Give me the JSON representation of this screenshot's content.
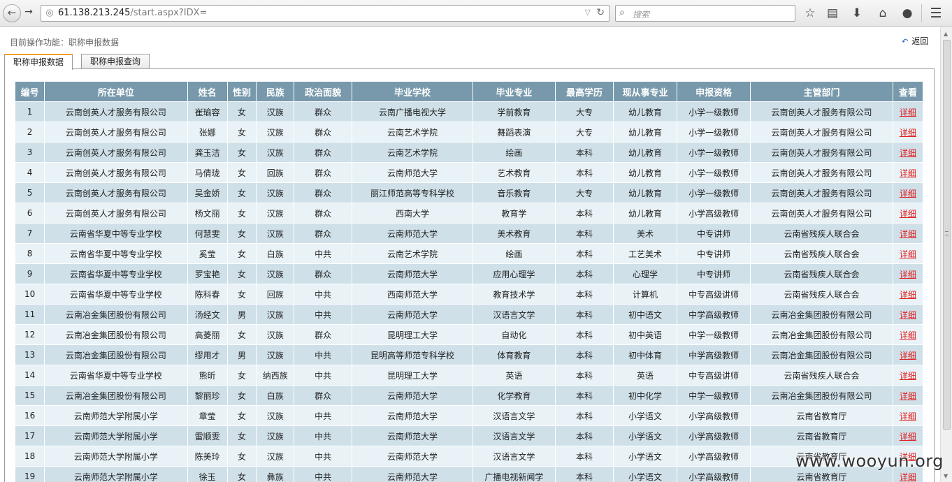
{
  "browser": {
    "url_host": "61.138.213.245",
    "url_path": "/start.aspx?IDX=",
    "search_placeholder": "搜索",
    "icons": [
      "back-icon",
      "forward-icon",
      "globe-icon",
      "reload-icon",
      "search-icon",
      "bookmark-star-icon",
      "reader-icon",
      "download-icon",
      "home-icon",
      "chat-icon",
      "menu-icon"
    ]
  },
  "page": {
    "operation_label": "目前操作功能：职称申报数据",
    "back_label": "返回",
    "tabs": [
      {
        "label": "职称申报数据",
        "active": true
      },
      {
        "label": "职称申报查询",
        "active": false
      }
    ]
  },
  "table": {
    "columns": [
      "编号",
      "所在单位",
      "姓名",
      "性别",
      "民族",
      "政治面貌",
      "毕业学校",
      "毕业专业",
      "最高学历",
      "现从事专业",
      "申报资格",
      "主管部门",
      "查看"
    ],
    "link_label": "详细",
    "rows": [
      [
        "1",
        "云南创英人才服务有限公司",
        "崔瑜容",
        "女",
        "汉族",
        "群众",
        "云南广播电视大学",
        "学前教育",
        "大专",
        "幼儿教育",
        "小学一级教师",
        "云南创英人才服务有限公司"
      ],
      [
        "2",
        "云南创英人才服务有限公司",
        "张娜",
        "女",
        "汉族",
        "群众",
        "云南艺术学院",
        "舞蹈表演",
        "大专",
        "幼儿教育",
        "小学一级教师",
        "云南创英人才服务有限公司"
      ],
      [
        "3",
        "云南创英人才服务有限公司",
        "龚玉洁",
        "女",
        "汉族",
        "群众",
        "云南艺术学院",
        "绘画",
        "本科",
        "幼儿教育",
        "小学一级教师",
        "云南创英人才服务有限公司"
      ],
      [
        "4",
        "云南创英人才服务有限公司",
        "马倩珑",
        "女",
        "回族",
        "群众",
        "云南师范大学",
        "艺术教育",
        "本科",
        "幼儿教育",
        "小学一级教师",
        "云南创英人才服务有限公司"
      ],
      [
        "5",
        "云南创英人才服务有限公司",
        "吴金娇",
        "女",
        "汉族",
        "群众",
        "丽江师范高等专科学校",
        "音乐教育",
        "大专",
        "幼儿教育",
        "小学一级教师",
        "云南创英人才服务有限公司"
      ],
      [
        "6",
        "云南创英人才服务有限公司",
        "杨文丽",
        "女",
        "汉族",
        "群众",
        "西南大学",
        "教育学",
        "本科",
        "幼儿教育",
        "小学高级教师",
        "云南创英人才服务有限公司"
      ],
      [
        "7",
        "云南省华夏中等专业学校",
        "何慧雯",
        "女",
        "汉族",
        "群众",
        "云南师范大学",
        "美术教育",
        "本科",
        "美术",
        "中专讲师",
        "云南省残疾人联合会"
      ],
      [
        "8",
        "云南省华夏中等专业学校",
        "奚莹",
        "女",
        "白族",
        "中共",
        "云南艺术学院",
        "绘画",
        "本科",
        "工艺美术",
        "中专讲师",
        "云南省残疾人联合会"
      ],
      [
        "9",
        "云南省华夏中等专业学校",
        "罗宝艳",
        "女",
        "汉族",
        "群众",
        "云南师范大学",
        "应用心理学",
        "本科",
        "心理学",
        "中专讲师",
        "云南省残疾人联合会"
      ],
      [
        "10",
        "云南省华夏中等专业学校",
        "陈科春",
        "女",
        "回族",
        "中共",
        "西南师范大学",
        "教育技术学",
        "本科",
        "计算机",
        "中专高级讲师",
        "云南省残疾人联合会"
      ],
      [
        "11",
        "云南冶金集团股份有限公司",
        "汤经文",
        "男",
        "汉族",
        "中共",
        "云南师范大学",
        "汉语言文学",
        "本科",
        "初中语文",
        "中学高级教师",
        "云南冶金集团股份有限公司"
      ],
      [
        "12",
        "云南冶金集团股份有限公司",
        "高菱丽",
        "女",
        "汉族",
        "群众",
        "昆明理工大学",
        "自动化",
        "本科",
        "初中英语",
        "中学一级教师",
        "云南冶金集团股份有限公司"
      ],
      [
        "13",
        "云南冶金集团股份有限公司",
        "缪用才",
        "男",
        "汉族",
        "中共",
        "昆明高等师范专科学校",
        "体育教育",
        "本科",
        "初中体育",
        "中学高级教师",
        "云南冶金集团股份有限公司"
      ],
      [
        "14",
        "云南省华夏中等专业学校",
        "熊昕",
        "女",
        "纳西族",
        "中共",
        "昆明理工大学",
        "英语",
        "本科",
        "英语",
        "中专高级讲师",
        "云南省残疾人联合会"
      ],
      [
        "15",
        "云南冶金集团股份有限公司",
        "黎丽珍",
        "女",
        "白族",
        "群众",
        "云南师范大学",
        "化学教育",
        "本科",
        "初中化学",
        "中学一级教师",
        "云南冶金集团股份有限公司"
      ],
      [
        "16",
        "云南师范大学附属小学",
        "章莹",
        "女",
        "汉族",
        "中共",
        "云南师范大学",
        "汉语言文学",
        "本科",
        "小学语文",
        "小学高级教师",
        "云南省教育厅"
      ],
      [
        "17",
        "云南师范大学附属小学",
        "雷顺雯",
        "女",
        "汉族",
        "中共",
        "云南师范大学",
        "汉语言文学",
        "本科",
        "小学语文",
        "小学高级教师",
        "云南省教育厅"
      ],
      [
        "18",
        "云南师范大学附属小学",
        "陈美玲",
        "女",
        "汉族",
        "中共",
        "云南师范大学",
        "汉语言文学",
        "本科",
        "小学语文",
        "小学高级教师",
        "云南省教育厅"
      ],
      [
        "19",
        "云南师范大学附属小学",
        "徐玉",
        "女",
        "彝族",
        "中共",
        "云南师范大学",
        "广播电视新闻学",
        "本科",
        "小学语文",
        "小学高级教师",
        "云南省教育厅"
      ]
    ]
  },
  "watermark": "www.wooyun.org"
}
